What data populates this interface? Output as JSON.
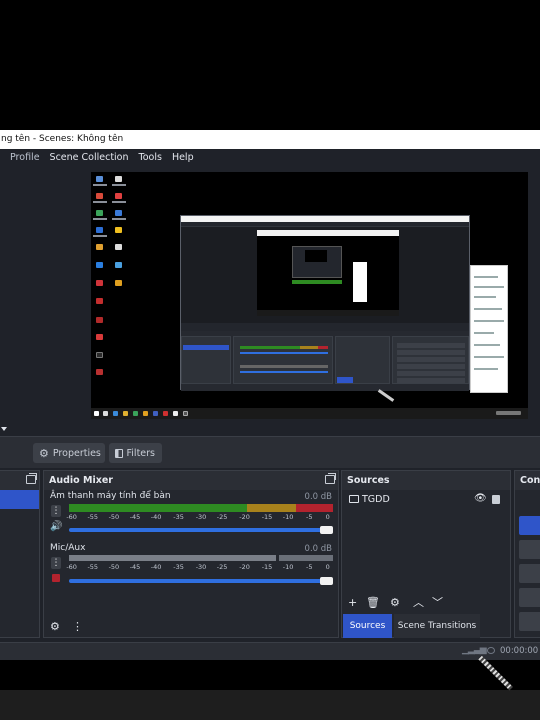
{
  "window": {
    "title": "ng tên - Scenes: Không tên"
  },
  "menu": {
    "items": [
      "Profile",
      "Scene Collection",
      "Tools",
      "Help"
    ]
  },
  "context_bar": {
    "properties_label": "Properties",
    "filters_label": "Filters"
  },
  "audio_mixer": {
    "title": "Audio Mixer",
    "scale": [
      "-60",
      "-55",
      "-50",
      "-45",
      "-40",
      "-35",
      "-30",
      "-25",
      "-20",
      "-15",
      "-10",
      "-5",
      "0"
    ],
    "channels": [
      {
        "name": "Âm thanh máy tính để bàn",
        "db": "0.0 dB",
        "level": 1.0,
        "muted": false
      },
      {
        "name": "Mic/Aux",
        "db": "0.0 dB",
        "level": 1.0,
        "muted": true
      }
    ]
  },
  "sources": {
    "title": "Sources",
    "items": [
      {
        "name": "TGDD",
        "visible": true,
        "locked": true
      }
    ],
    "tabs": [
      "Sources",
      "Scene Transitions"
    ],
    "active_tab": "Sources"
  },
  "controls": {
    "title": "Cont"
  },
  "status": {
    "time": "00:00:00"
  },
  "colors": {
    "accent": "#2f55c9",
    "meter_green": "#2e8b22",
    "meter_yellow": "#a8821c",
    "meter_red": "#b3232e"
  },
  "icons": {
    "properties": "gear-icon",
    "filters": "filter-icon",
    "visibility": "eye-icon",
    "lock": "lock-icon",
    "add": "plus-icon",
    "remove": "trash-icon",
    "settings": "gear-icon",
    "up": "arrow-up-icon",
    "down": "arrow-down-icon"
  }
}
